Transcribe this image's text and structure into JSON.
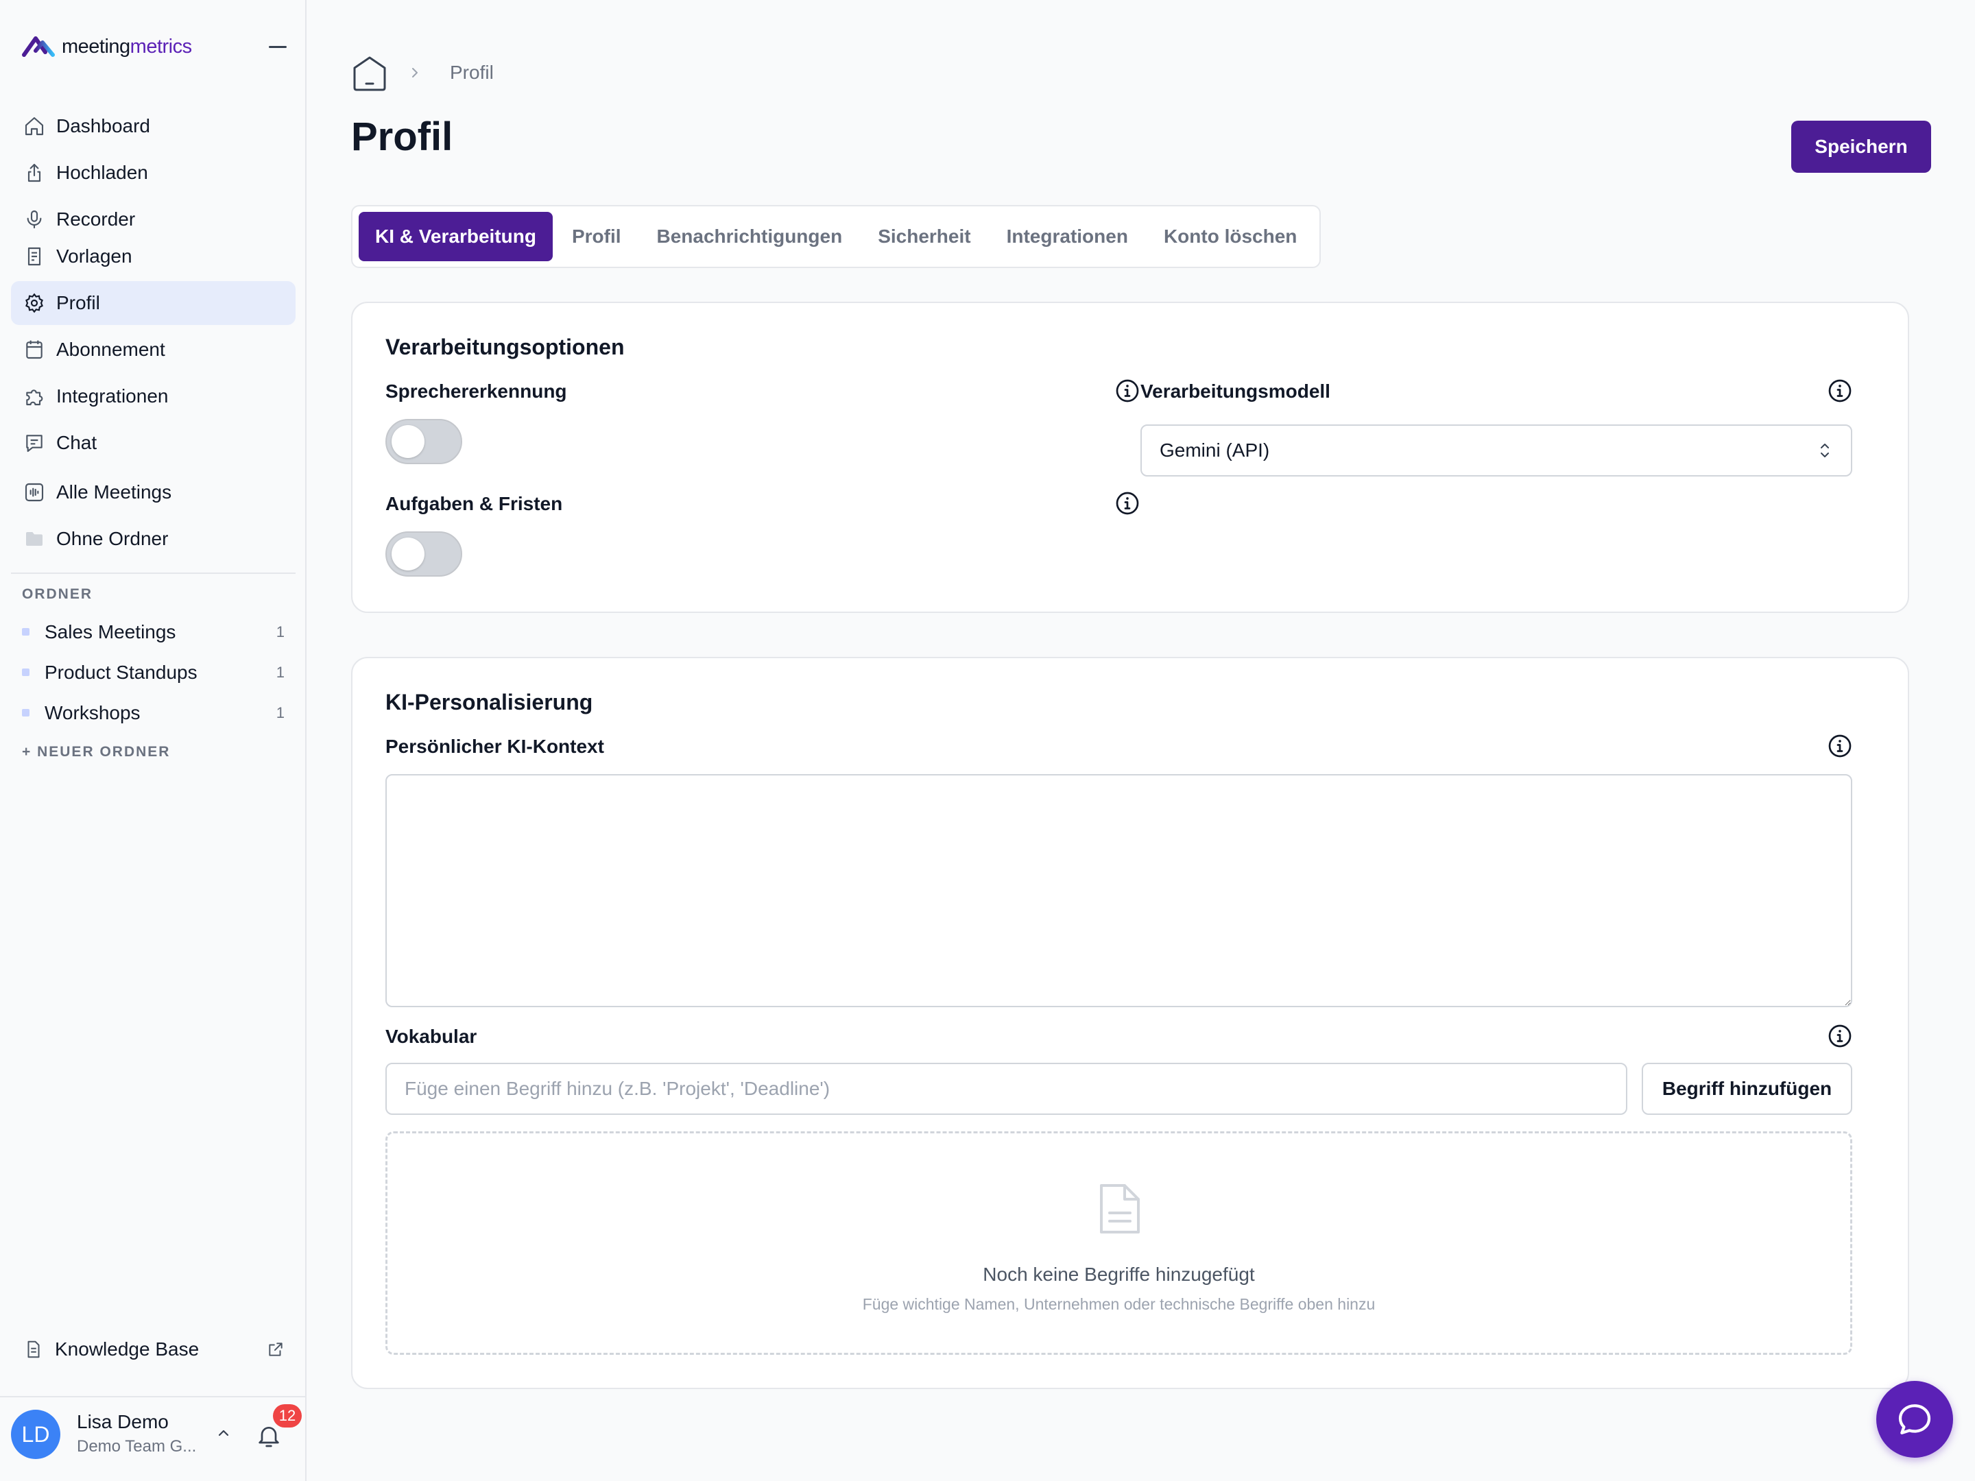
{
  "brand": {
    "name_part1": "meeting",
    "name_part2": "metrics"
  },
  "sidebar": {
    "nav": [
      {
        "label": "Dashboard",
        "icon": "home-icon"
      },
      {
        "label": "Hochladen",
        "icon": "upload-icon"
      },
      {
        "label": "Recorder",
        "icon": "microphone-icon"
      },
      {
        "label": "Vorlagen",
        "icon": "template-icon"
      },
      {
        "label": "Profil",
        "icon": "gear-icon",
        "active": true
      },
      {
        "label": "Abonnement",
        "icon": "subscription-icon"
      },
      {
        "label": "Integrationen",
        "icon": "puzzle-icon"
      },
      {
        "label": "Chat",
        "icon": "chat-icon"
      },
      {
        "label": "Alle Meetings",
        "icon": "waveform-icon"
      },
      {
        "label": "Ohne Ordner",
        "icon": "folder-icon"
      }
    ],
    "folders_heading": "ORDNER",
    "folders": [
      {
        "label": "Sales Meetings",
        "count": "1"
      },
      {
        "label": "Product Standups",
        "count": "1"
      },
      {
        "label": "Workshops",
        "count": "1"
      }
    ],
    "new_folder": "+ NEUER ORDNER",
    "knowledge_base": "Knowledge Base",
    "user": {
      "initials": "LD",
      "name": "Lisa Demo",
      "team": "Demo Team G...",
      "notifications": "12"
    }
  },
  "breadcrumb": {
    "current": "Profil"
  },
  "page": {
    "title": "Profil",
    "save_label": "Speichern"
  },
  "tabs": [
    {
      "label": "KI & Verarbeitung",
      "active": true
    },
    {
      "label": "Profil"
    },
    {
      "label": "Benachrichtigungen"
    },
    {
      "label": "Sicherheit"
    },
    {
      "label": "Integrationen"
    },
    {
      "label": "Konto löschen"
    }
  ],
  "processing": {
    "title": "Verarbeitungsoptionen",
    "speaker_label": "Sprechererkennung",
    "speaker_enabled": false,
    "tasks_label": "Aufgaben & Fristen",
    "tasks_enabled": false,
    "model_label": "Verarbeitungsmodell",
    "model_value": "Gemini (API)"
  },
  "personalization": {
    "title": "KI-Personalisierung",
    "context_label": "Persönlicher KI-Kontext",
    "context_value": "",
    "vocab_label": "Vokabular",
    "vocab_placeholder": "Füge einen Begriff hinzu (z.B. 'Projekt', 'Deadline')",
    "add_label": "Begriff hinzufügen",
    "empty_title": "Noch keine Begriffe hinzugefügt",
    "empty_sub": "Füge wichtige Namen, Unternehmen oder technische Begriffe oben hinzu"
  },
  "colors": {
    "accent": "#4c1d95",
    "fab": "#5b21b6",
    "badge": "#ef4444",
    "avatar": "#3b82f6",
    "active_nav": "#e6ecfb"
  }
}
